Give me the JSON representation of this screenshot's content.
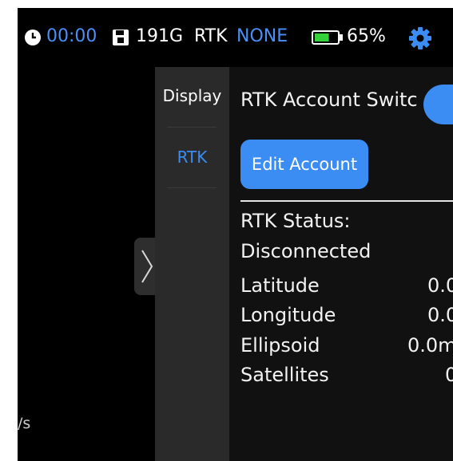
{
  "status_bar": {
    "time": "00:00",
    "storage": "191G",
    "rtk_label": "RTK",
    "rtk_value": "NONE",
    "battery": "65%",
    "battery_level": 0.65,
    "icons": [
      "clock-icon",
      "sd-card-icon",
      "battery-icon",
      "gear-icon"
    ]
  },
  "left_overlay": {
    "speed_unit_fragment": "/s"
  },
  "tabs": [
    {
      "label": "Display",
      "active": false
    },
    {
      "label": "RTK",
      "active": true
    }
  ],
  "rtk_panel": {
    "account_switch_label": "RTK Account Switc",
    "account_switch_on": true,
    "edit_account_label": "Edit Account",
    "status_label": "RTK Status:",
    "status_value": "Disconnected",
    "fields": [
      {
        "label": "Latitude",
        "value": "0.0"
      },
      {
        "label": "Longitude",
        "value": "0.0"
      },
      {
        "label": "Ellipsoid",
        "value": "0.0m"
      },
      {
        "label": "Satellites",
        "value": "0"
      }
    ]
  },
  "colors": {
    "accent": "#3b8cf3",
    "status_text": "#ffffff",
    "rtk_none": "#4a8ff7",
    "battery_fill": "#35d13a",
    "panel_bg": "#111111",
    "tab_bg": "#2a2a2a"
  }
}
